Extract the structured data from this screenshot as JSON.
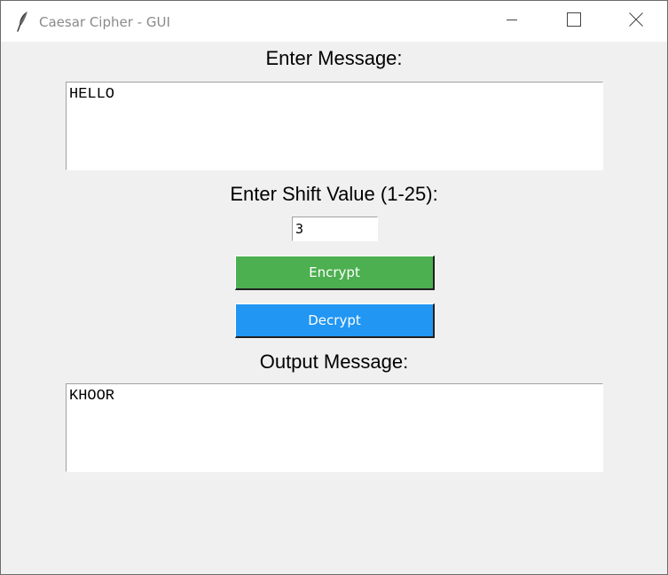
{
  "window": {
    "title": "Caesar Cipher - GUI",
    "icon": "feather-icon",
    "controls": [
      "minimize-icon",
      "maximize-icon",
      "close-icon"
    ]
  },
  "form": {
    "message_label": "Enter Message:",
    "message_value": "HELLO",
    "shift_label": "Enter Shift Value (1-25):",
    "shift_value": "3",
    "encrypt_label": "Encrypt",
    "decrypt_label": "Decrypt",
    "output_label": "Output Message:",
    "output_value": "KHOOR"
  },
  "colors": {
    "encrypt_button": "#4caf50",
    "decrypt_button": "#2196f3",
    "window_background": "#f0f0f0"
  }
}
